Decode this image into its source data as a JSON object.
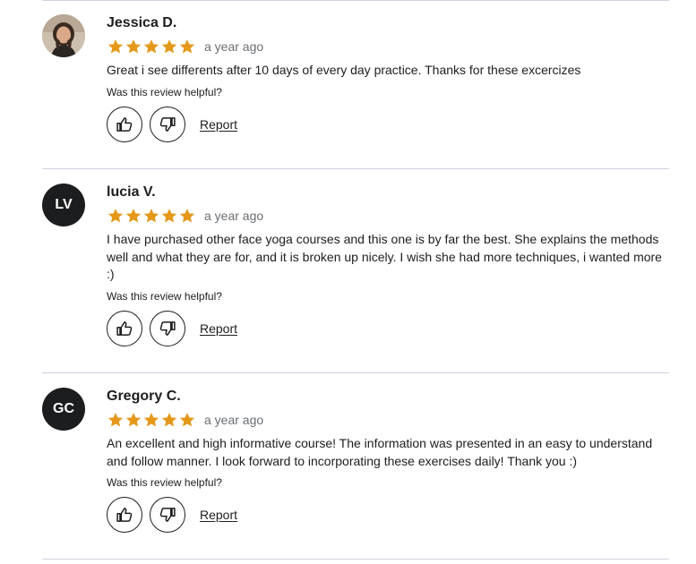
{
  "reviews": [
    {
      "name": "Jessica D.",
      "avatar": {
        "type": "photo",
        "initials": ""
      },
      "rating": 5,
      "date": "a year ago",
      "text": "Great i see differents after 10 days of every day practice. Thanks for these excercizes",
      "helpful_prompt": "Was this review helpful?",
      "report_label": "Report"
    },
    {
      "name": "lucia V.",
      "avatar": {
        "type": "initials",
        "initials": "LV"
      },
      "rating": 5,
      "date": "a year ago",
      "text": "I have purchased other face yoga courses and this one is by far the best. She explains the methods well and what they are for, and it is broken up nicely. I wish she had more techniques, i wanted more :)",
      "helpful_prompt": "Was this review helpful?",
      "report_label": "Report"
    },
    {
      "name": "Gregory C.",
      "avatar": {
        "type": "initials",
        "initials": "GC"
      },
      "rating": 5,
      "date": "a year ago",
      "text": "An excellent and high informative course! The information was presented in an easy to understand and follow manner. I look forward to incorporating these exercises daily! Thank you :)",
      "helpful_prompt": "Was this review helpful?",
      "report_label": "Report"
    }
  ],
  "icons": {
    "star": "star-icon",
    "thumbs_up": "thumbs-up-icon",
    "thumbs_down": "thumbs-down-icon"
  },
  "colors": {
    "star": "#e59819",
    "divider": "#d1d2e0",
    "avatar_bg": "#1c1d1f",
    "muted_text": "#6a6f73"
  }
}
